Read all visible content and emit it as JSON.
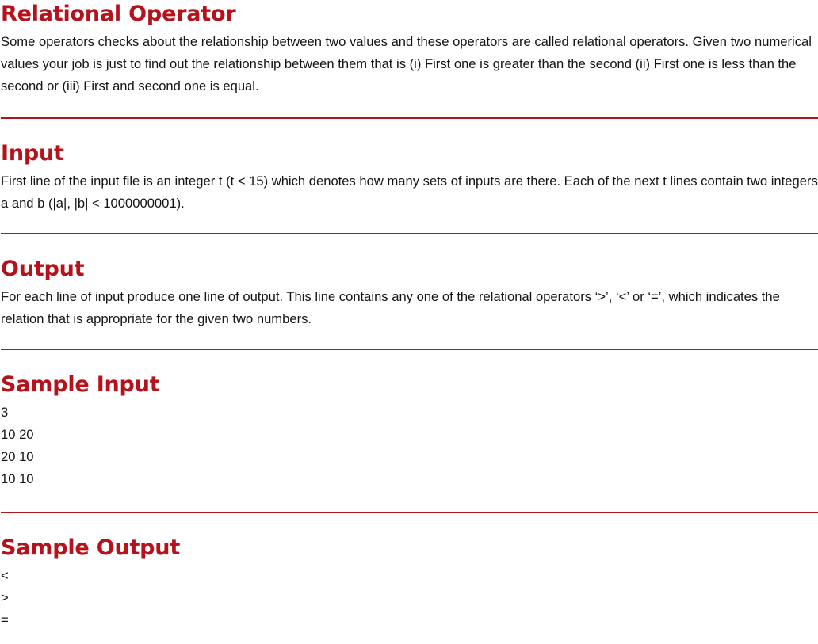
{
  "colors": {
    "accent": "#b5121b",
    "text": "#141414"
  },
  "sections": {
    "problem": {
      "title": "Relational Operator",
      "text": "Some operators checks about the relationship between two values and these operators are called relational operators. Given two numerical values your job is just to find out the relationship between them that is (i) First one is greater than the second (ii) First one is less than the second or (iii) First and second one is equal."
    },
    "input": {
      "title": "Input",
      "text": "First line of the input file is an integer t (t < 15) which denotes how many sets of inputs are there. Each of the next t lines contain two integers a and b (|a|, |b| < 1000000001)."
    },
    "output": {
      "title": "Output",
      "text": "For each line of input produce one line of output. This line contains any one of the relational operators ‘>’, ‘<’ or ‘=’, which indicates the relation that is appropriate for the given two numbers."
    },
    "sample_input": {
      "title": "Sample Input",
      "lines": [
        "3",
        "10 20",
        "20 10",
        "10 10"
      ]
    },
    "sample_output": {
      "title": "Sample Output",
      "lines": [
        "<",
        ">",
        "="
      ]
    }
  }
}
